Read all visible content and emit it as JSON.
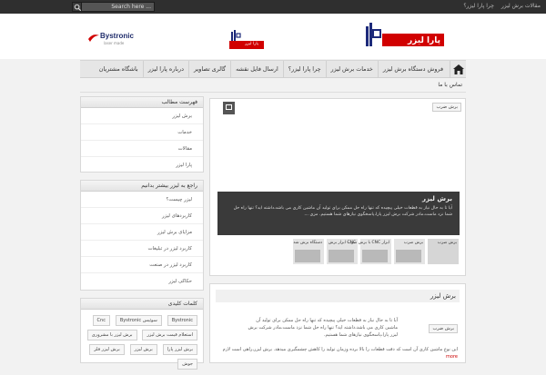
{
  "topbar": {
    "search_placeholder": "Search here ...",
    "links": [
      "مقالات برش لیزر",
      "چرا پارا لیزر؟"
    ]
  },
  "header": {
    "logo_text": "پارا لیزر",
    "small_logo_text": "پارا لیزر",
    "partner_logo": "Bystronic",
    "partner_sub": "laser made"
  },
  "nav": {
    "items": [
      "فروش دستگاه برش لیزر",
      "خدمات برش لیزر",
      "چرا پارا لیزر؟",
      "ارسال فایل نقشه",
      "گالری تصاویر",
      "درباره پارا لیزر",
      "باشگاه مشتریان"
    ],
    "sub": "تماس با ما"
  },
  "sidebar": {
    "toc": {
      "title": "فهرست مطالب",
      "items": [
        "برش لیزر",
        "خدمات",
        "مقالات",
        "پارا لیزر"
      ]
    },
    "more": {
      "title": "راجع به لیزر بیشتر بدانیم",
      "items": [
        "لیزر چیست؟",
        "کاربردهای لیزر",
        "مزایای برش لیزر",
        "کاربرد لیزر در تبلیغات",
        "کاربرد لیزر در صنعت",
        "حکاکی لیزر"
      ]
    },
    "keywords": {
      "title": "کلمات کلیدی",
      "tags": [
        "Bystronic",
        "سوئیس Bystronic",
        "Cnc",
        "استعلام قیمت برش لیزر",
        "برش لیزر با مشروری",
        "برش لیزر پارا",
        "برش لیزر",
        "برش لیزر فلز",
        "جوش"
      ]
    }
  },
  "slider": {
    "tag": "برش ضرب",
    "caption_title": "برش لیزر",
    "caption_text": "آیا تا به حال نیاز به قطعات خیلی پیچیده که تنها راه حل ممکن برای تولید آن ماشین کاری می باشد،داشته اید؟ تنها راه حل شما نزد ماست،مادر شرکت برش لیزر پارا،پاسخگوی نیازهای شما هستیم. مزی ...",
    "thumbs": [
      "برش ضرب",
      "برش ضرب",
      "ابزار CNC با برش ضرب",
      "CNC ابزار برش",
      "دستگاه برش شد"
    ]
  },
  "post": {
    "title": "برش لیزر",
    "tag": "برش ضرب",
    "text": "آیا تا به حال نیاز به قطعات خیلی پیچیده که تنها راه حل ممکن برای تولید آن ماشین کاری می باشد،داشته اید؟ تنها راه حل شما نزد ماست،مادر شرکت برش لیزر پارا،پاسخگوی نیازهای شما هستیم.",
    "text2": "این نوع ماشین کاری آن است که دقت قطعات را بالا برده وزمان تولید را کاهش چشمگیری میدهد. برش لیزر،راهی است لازم",
    "more": "more"
  },
  "colors": {
    "accent": "#c00000",
    "topbar": "#2f2f2f",
    "caption_bg": "#3a3a3a"
  }
}
